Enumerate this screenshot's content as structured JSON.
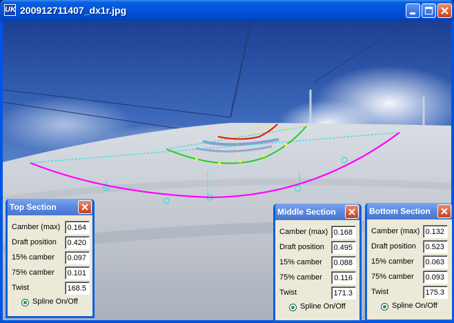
{
  "window": {
    "title": "200912711407_dx1r.jpg",
    "icon": "UK"
  },
  "caption_buttons": {
    "minimize": "minimize-icon",
    "maximize": "maximize-icon",
    "close": "close-icon"
  },
  "panels": {
    "top": {
      "title": "Top Section",
      "rows": [
        {
          "label": "Camber (max)",
          "value": "0.164"
        },
        {
          "label": "Draft position",
          "value": "0.420"
        },
        {
          "label": "15% camber",
          "value": "0.097"
        },
        {
          "label": "75% camber",
          "value": "0.101"
        },
        {
          "label": "Twist",
          "value": "168.5"
        }
      ],
      "spline_label": "Spline On/Off"
    },
    "middle": {
      "title": "Middle Section",
      "rows": [
        {
          "label": "Camber (max)",
          "value": "0.168"
        },
        {
          "label": "Draft position",
          "value": "0.495"
        },
        {
          "label": "15% camber",
          "value": "0.088"
        },
        {
          "label": "75% camber",
          "value": "0.116"
        },
        {
          "label": "Twist",
          "value": "171.3"
        }
      ],
      "spline_label": "Spline On/Off"
    },
    "bottom": {
      "title": "Bottom Section",
      "rows": [
        {
          "label": "Camber (max)",
          "value": "0.132"
        },
        {
          "label": "Draft position",
          "value": "0.523"
        },
        {
          "label": "15% camber",
          "value": "0.063"
        },
        {
          "label": "75% camber",
          "value": "0.093"
        },
        {
          "label": "Twist",
          "value": "175.3"
        }
      ],
      "spline_label": "Spline On/Off"
    }
  },
  "colors": {
    "top_curve": "#ff00ff",
    "middle_curve": "#22cc22",
    "bottom_curve": "#dd1111",
    "chord_line": "#33dddd",
    "guide_line": "#ffee44"
  }
}
